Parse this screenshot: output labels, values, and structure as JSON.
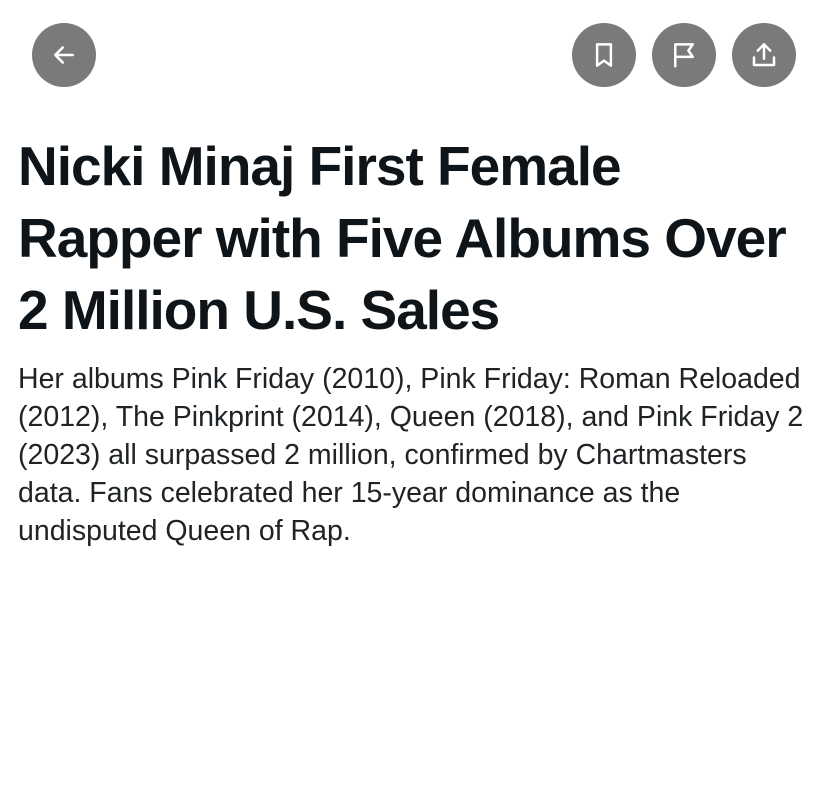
{
  "toolbar": {
    "back_icon": "arrow-left-icon",
    "bookmark_icon": "bookmark-icon",
    "report_icon": "flag-icon",
    "share_icon": "share-upload-icon",
    "button_color": "#7a7a7a"
  },
  "article": {
    "headline": "Nicki Minaj First Female Rapper with Five Albums Over 2 Million U.S. Sales",
    "summary": "Her albums Pink Friday (2010), Pink Friday: Roman Reloaded (2012), The Pinkprint (2014), Queen (2018), and Pink Friday 2 (2023) all surpassed 2 million, confirmed by Chartmasters data. Fans celebrated her 15-year dominance as the undisputed Queen of Rap."
  }
}
